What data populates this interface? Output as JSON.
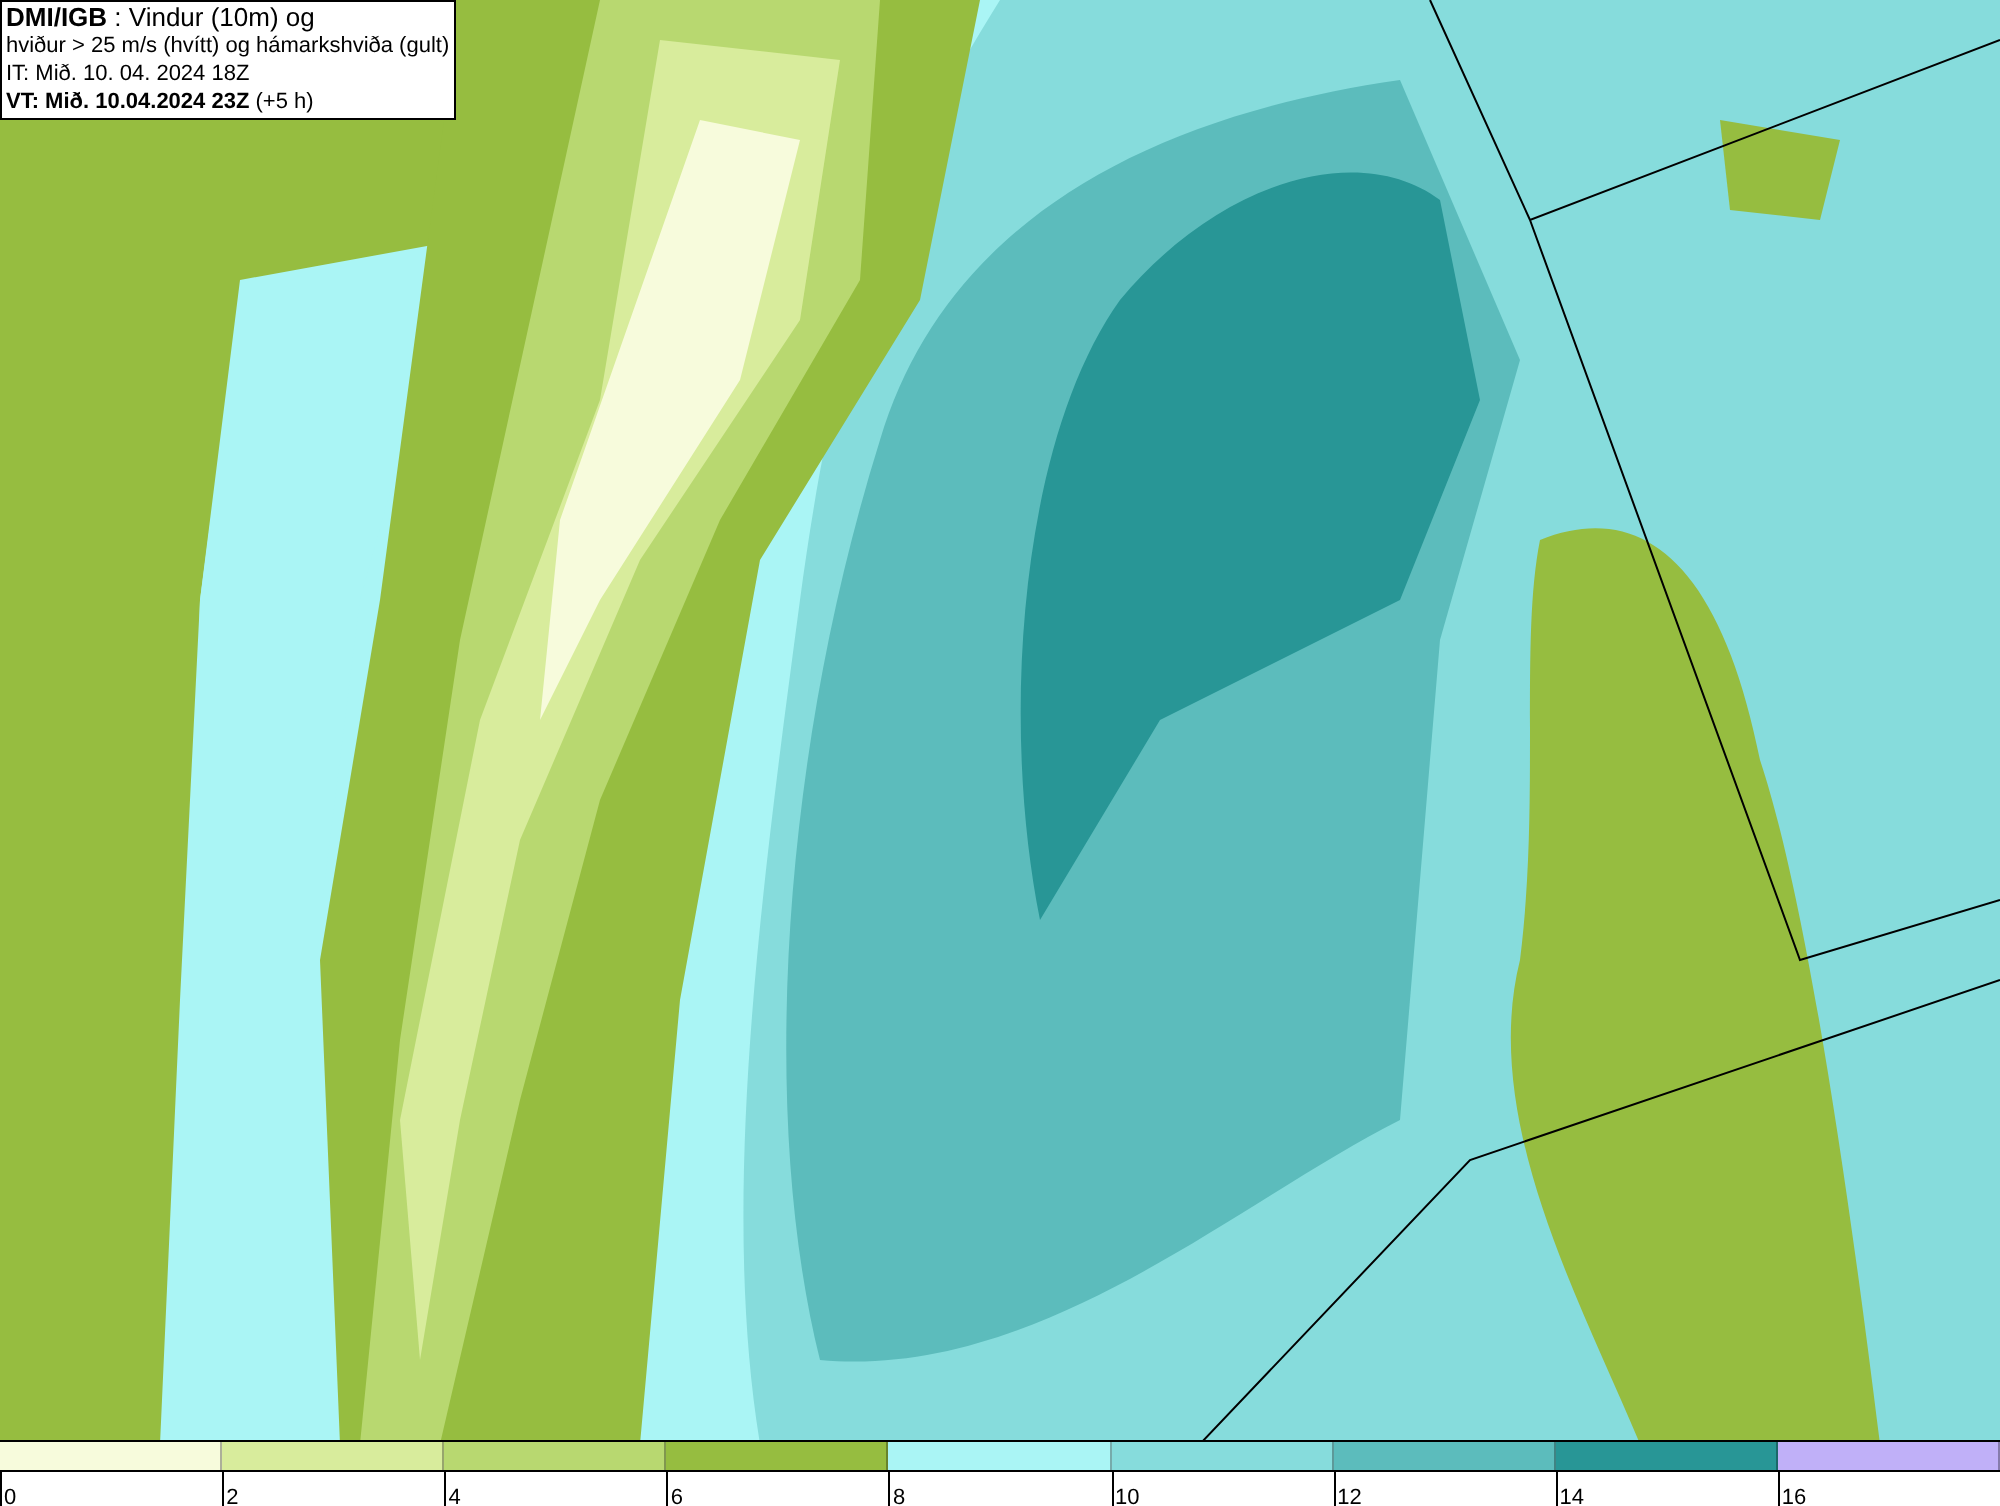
{
  "title_box": {
    "lines": [
      "**DMI/IGB** : Vindur (10m) og",
      "hviður > 25 m/s (hvítt) og hámarkshviða (gult)",
      "IT: Mið. 10. 04. 2024 18Z",
      "**VT: Mið. 10.04.2024 23Z** (+5 h)"
    ]
  },
  "legend": {
    "segments": [
      {
        "color": "#f7fbdc"
      },
      {
        "color": "#d8ec9c"
      },
      {
        "color": "#b8d870"
      },
      {
        "color": "#96bd40"
      },
      {
        "color": "#aaf5f5"
      },
      {
        "color": "#86dcdc"
      },
      {
        "color": "#5cbcbc"
      },
      {
        "color": "#289696"
      },
      {
        "color": "#c0b0f8"
      }
    ],
    "ticks": [
      "0",
      "2",
      "4",
      "6",
      "8",
      "10",
      "12",
      "14",
      "16"
    ]
  }
}
